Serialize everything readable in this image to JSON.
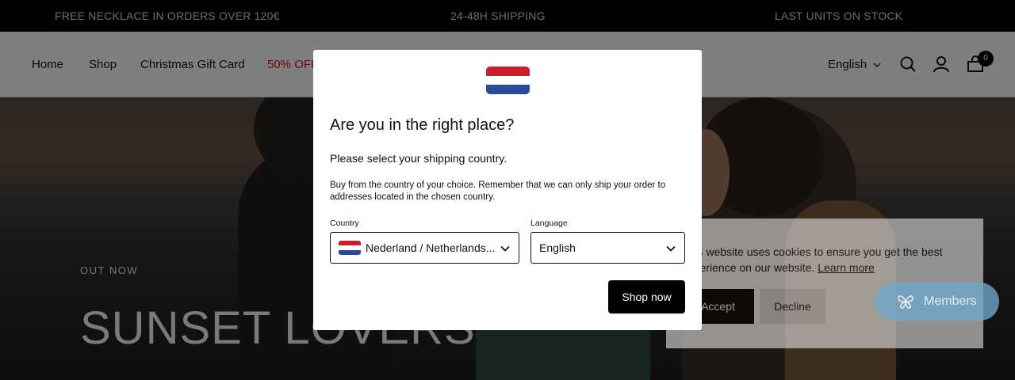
{
  "announcement": {
    "items": [
      "FREE NECKLACE IN ORDERS OVER 120€",
      "24-48H SHIPPING",
      "LAST UNITS ON STOCK"
    ]
  },
  "header": {
    "nav": [
      "Home",
      "Shop",
      "Christmas Gift Card",
      "50% OFF"
    ],
    "language": "English",
    "cart_count": "0",
    "icons": [
      "search-icon",
      "account-icon",
      "cart-icon",
      "chevron-down-icon"
    ]
  },
  "hero": {
    "kicker": "OUT NOW",
    "title": "SUNSET LOVERS"
  },
  "cookie": {
    "text": "This website uses cookies to ensure you get the best experience on our website.",
    "link": "Learn more",
    "accept": "Accept",
    "decline": "Decline"
  },
  "members": {
    "label": "Members",
    "icon": "butterfly-icon"
  },
  "modal": {
    "title": "Are you in the right place?",
    "subtitle": "Please select your shipping country.",
    "description": "Buy from the country of your choice. Remember that we can only ship your order to addresses located in the chosen country.",
    "country_label": "Country",
    "country_value": "Nederland / Netherlands...",
    "language_label": "Language",
    "language_value": "English",
    "button": "Shop now",
    "flag": "netherlands-flag",
    "colors": {
      "flag_red": "#c8202f",
      "flag_white": "#ffffff",
      "flag_blue": "#2a4a9a"
    }
  },
  "colors": {
    "sale": "#dd1111",
    "members_pill": "#6fa8c9"
  }
}
